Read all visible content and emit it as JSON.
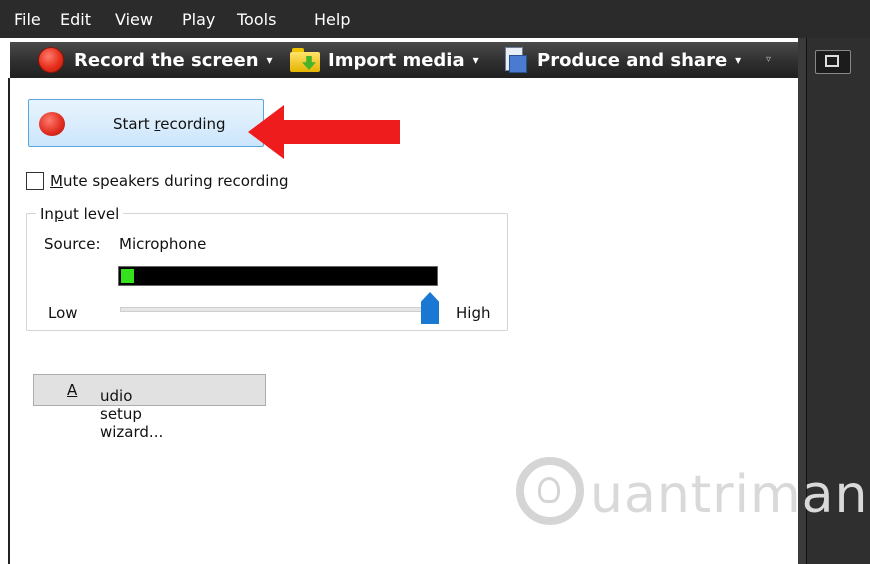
{
  "menu": {
    "items": [
      "File",
      "Edit",
      "View",
      "Play",
      "Tools",
      "Help"
    ]
  },
  "toolbar": {
    "record_label": "Record the screen",
    "import_label": "Import media",
    "produce_label": "Produce and share",
    "caret": "▾",
    "overflow": "▿"
  },
  "panel": {
    "start_button": {
      "pre": "Start ",
      "accel": "r",
      "post": "ecording"
    },
    "mute": {
      "accel": "M",
      "post": "ute speakers during recording",
      "checked": false
    },
    "input_group": {
      "pre": "In",
      "accel": "p",
      "post": "ut level"
    },
    "source_label": "Source:",
    "source_value": "Microphone",
    "meter_level_fraction": 0.04,
    "slider": {
      "low_label": "Low",
      "high_label": "High",
      "value_fraction": 0.98
    },
    "wizard": {
      "accel": "A",
      "post": "udio setup wizard..."
    }
  },
  "watermark": {
    "text": "uantrimang"
  },
  "colors": {
    "accent_red": "#ee1c1c",
    "meter_green": "#35e11c",
    "slider_blue": "#1a78d2"
  },
  "icons": {
    "record": "record-dot-icon",
    "import": "folder-import-icon",
    "produce": "produce-share-icon",
    "panel_toggle": "panel-toggle-icon"
  }
}
